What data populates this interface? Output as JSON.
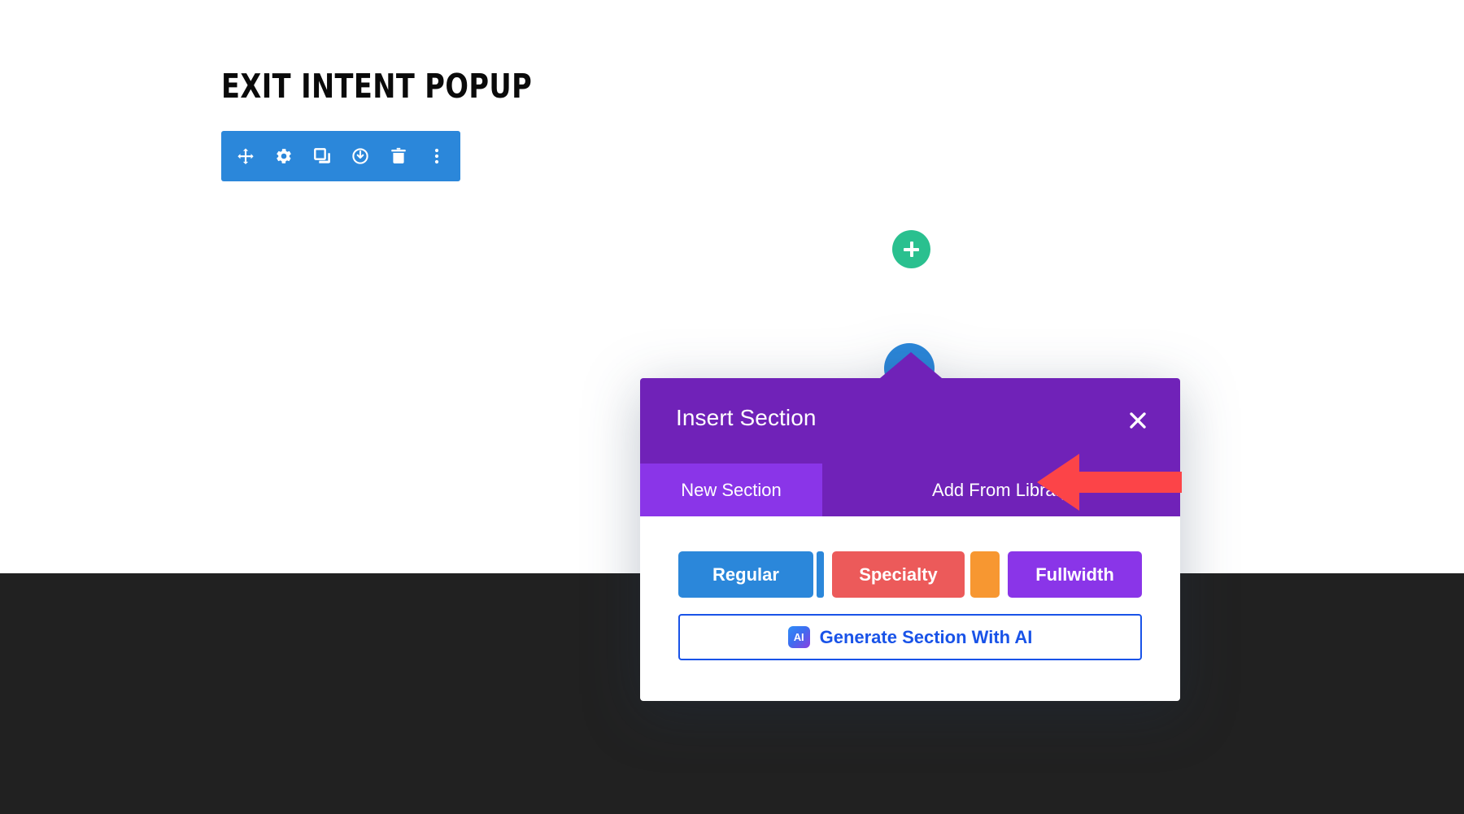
{
  "page": {
    "heading": "EXIT INTENT POPUP",
    "background_color": "#ffffff",
    "dark_section_color": "#212121"
  },
  "module_toolbar": {
    "background_color": "#2b87da",
    "buttons": [
      {
        "name": "move-icon",
        "label": "Move"
      },
      {
        "name": "gear-icon",
        "label": "Settings"
      },
      {
        "name": "duplicate-icon",
        "label": "Duplicate"
      },
      {
        "name": "power-icon",
        "label": "Disable"
      },
      {
        "name": "trash-icon",
        "label": "Delete"
      },
      {
        "name": "more-options-icon",
        "label": "More Options"
      }
    ]
  },
  "canvas_controls": {
    "add_row": {
      "label": "+",
      "color": "#2ac08f"
    },
    "add_section": {
      "label": "+",
      "color": "#2b87da"
    }
  },
  "modal": {
    "title": "Insert Section",
    "close_label": "✕",
    "header_color": "#7022b8",
    "tabs": [
      {
        "label": "New Section",
        "active": true,
        "color": "#8a35e8"
      },
      {
        "label": "Add From Library",
        "active": false,
        "color": "#7022b8"
      }
    ],
    "section_types": [
      {
        "label": "Regular",
        "color": "#2b87da"
      },
      {
        "label": "Specialty",
        "color": "#ec5a5a"
      },
      {
        "label": "Fullwidth",
        "color": "#8a35e8"
      }
    ],
    "accent_bars": [
      {
        "name": "regular-column-bar",
        "color": "#2b87da"
      },
      {
        "name": "specialty-sidebar-bar",
        "color": "#f79731"
      }
    ],
    "generate_ai": {
      "label": "Generate Section With AI",
      "badge_text": "AI",
      "border_color": "#1953e8",
      "text_color": "#1953e8"
    }
  },
  "annotation": {
    "arrow_color": "#fc4448",
    "points_to": "Add From Library"
  }
}
